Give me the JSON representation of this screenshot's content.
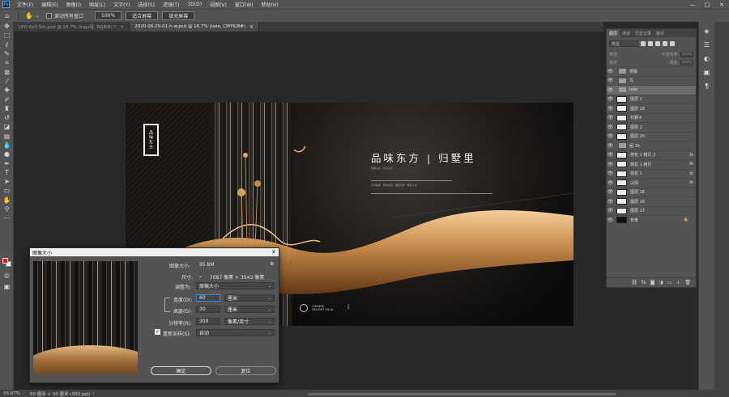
{
  "app": {
    "logo": "Ps"
  },
  "menu": [
    "文件(F)",
    "编辑(E)",
    "图像(I)",
    "图层(L)",
    "文字(Y)",
    "选择(S)",
    "滤镜(T)",
    "3D(D)",
    "视图(V)",
    "窗口(W)",
    "帮助(H)"
  ],
  "window_controls": {
    "minimize": "—",
    "maximize": "□",
    "close": "✕"
  },
  "options": {
    "scroll_all_label": "滚动所有窗口",
    "zoom_value": "100%",
    "fit_screen": "适合屏幕",
    "fill_screen": "填充屏幕"
  },
  "tabs": [
    {
      "label": "LED-6x3.5m.psd @ 16.7% (logo组, RGB/8) *",
      "close": "×"
    },
    {
      "label": "2020-06-29-01-h-w.psd @ 16.7% (lake, CMYK/8#)",
      "close": "×"
    }
  ],
  "canvas_art": {
    "seal": "品味东方",
    "headline": "品味东方 | 归墅里",
    "subline_1": "墅藏山水 · 归心东方",
    "subline_2": "东方雅居 · 传世名邸 · 御园湾畔 · 尊享人生",
    "villa": "VILLA",
    "logo_line1": "CHINESE",
    "logo_line2": "DELIGHT VILLA"
  },
  "layers_panel": {
    "tabs": [
      "图层",
      "通道",
      "历史记录",
      "路径"
    ],
    "filter_label": "类型",
    "blend_mode": "穿透",
    "opacity_label": "不透明度:",
    "opacity_value": "100%",
    "lock_label": "锁定:",
    "fill_label": "填充:",
    "fill_value": "100%",
    "layers": [
      {
        "name": "排版",
        "kind": "folder",
        "fx": "",
        "selected": false
      },
      {
        "name": "鸟",
        "kind": "folder",
        "fx": "",
        "selected": false
      },
      {
        "name": "lake",
        "kind": "folder",
        "fx": "",
        "selected": true
      },
      {
        "name": "图层 1",
        "kind": "layer",
        "fx": "",
        "selected": false
      },
      {
        "name": "图层 19",
        "kind": "layer",
        "fx": "",
        "selected": false
      },
      {
        "name": "石狮子",
        "kind": "layer",
        "fx": "",
        "selected": false
      },
      {
        "name": "图层 2",
        "kind": "layer",
        "fx": "",
        "selected": false
      },
      {
        "name": "图层 20",
        "kind": "layer",
        "fx": "",
        "selected": false
      },
      {
        "name": "组 16",
        "kind": "folder",
        "fx": "",
        "selected": false
      },
      {
        "name": "荷花 1 拷贝 2",
        "kind": "layer",
        "fx": "fx",
        "selected": false
      },
      {
        "name": "荷花 1 拷贝",
        "kind": "layer",
        "fx": "fx",
        "selected": false
      },
      {
        "name": "荷花 1",
        "kind": "layer",
        "fx": "fx",
        "selected": false
      },
      {
        "name": "山师",
        "kind": "layer",
        "fx": "fx",
        "selected": false
      },
      {
        "name": "图层 18",
        "kind": "layer",
        "fx": "",
        "selected": false
      },
      {
        "name": "图层 16",
        "kind": "layer",
        "fx": "",
        "selected": false
      },
      {
        "name": "图层 17",
        "kind": "layer",
        "fx": "",
        "selected": false
      },
      {
        "name": "背景",
        "kind": "background",
        "fx": "",
        "selected": false
      }
    ]
  },
  "dialog": {
    "title": "图像大小",
    "image_size_label": "图像大小:",
    "image_size_value": "95.8M",
    "dimensions_label": "尺寸:",
    "dimensions_value": "7087 像素 × 3543 像素",
    "fit_to_label": "调整为:",
    "fit_to_value": "原稿大小",
    "width_label": "宽度(D):",
    "width_value": "60",
    "width_unit": "厘米",
    "height_label": "高度(G):",
    "height_value": "30",
    "height_unit": "厘米",
    "resolution_label": "分辨率(R):",
    "resolution_value": "300",
    "resolution_unit": "像素/英寸",
    "resample_label": "重新采样(S):",
    "resample_value": "自动",
    "ok": "确定",
    "reset": "复位"
  },
  "status": {
    "zoom": "16.67%",
    "doc_info": "60 厘米 × 30 厘米 (300 ppi)"
  }
}
